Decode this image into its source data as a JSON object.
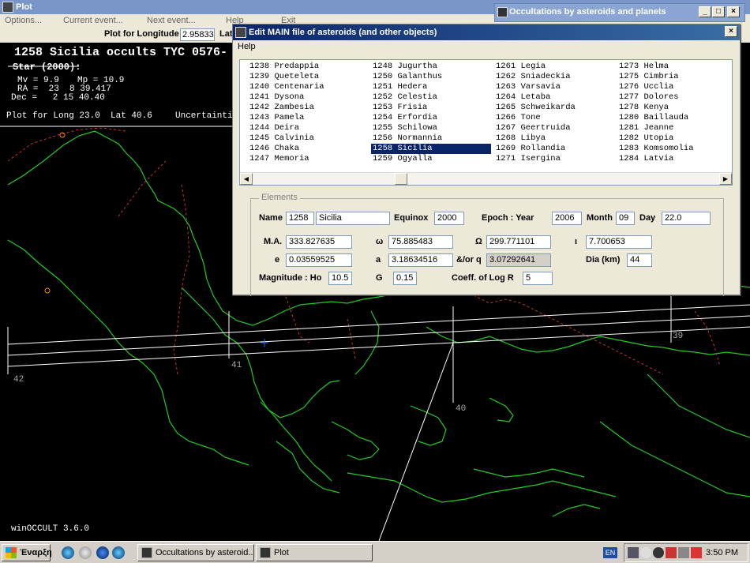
{
  "plot_window": {
    "title": "Plot",
    "menu": [
      "Options...",
      "Current event...",
      "Next event...",
      "Help",
      "Exit"
    ],
    "toolbar": {
      "longitude_label": "Plot for Longitude",
      "longitude_value": "2.95833",
      "lat_label": "Lat"
    },
    "header": {
      "event_title": "1258 Sicilia occults TYC 0576-",
      "star_heading": "Star (2000):",
      "mv": "Mv = 9.9",
      "mp": "Mp = 10.9",
      "ra": "RA =  23  8 39.417",
      "dec": "Dec =   2 15 40.40",
      "plot_for": "Plot for Long 23.0  Lat 40.6",
      "uncertainty": "Uncertainti"
    },
    "lat_labels": [
      "42",
      "41",
      "40",
      "39"
    ],
    "version": "winOCCULT 3.6.0"
  },
  "occultations_window": {
    "title": "Occultations by asteroids and planets"
  },
  "edit_window": {
    "title": "Edit MAIN file of asteroids (and other objects)",
    "menu": "Help",
    "asteroid_columns": [
      [
        "1238 Predappia",
        "1239 Queteleta",
        "1240 Centenaria",
        "1241 Dysona",
        "1242 Zambesia",
        "1243 Pamela",
        "1244 Deira",
        "1245 Calvinia",
        "1246 Chaka",
        "1247 Memoria"
      ],
      [
        "1248 Jugurtha",
        "1250 Galanthus",
        "1251 Hedera",
        "1252 Celestia",
        "1253 Frisia",
        "1254 Erfordia",
        "1255 Schilowa",
        "1256 Normannia",
        "1258 Sicilia",
        "1259 Ogyalla"
      ],
      [
        "1261 Legia",
        "1262 Sniadeckia",
        "1263 Varsavia",
        "1264 Letaba",
        "1265 Schweikarda",
        "1266 Tone",
        "1267 Geertruida",
        "1268 Libya",
        "1269 Rollandia",
        "1271 Isergina"
      ],
      [
        "1273 Helma",
        "1275 Cimbria",
        "1276 Ucclia",
        "1277 Dolores",
        "1278 Kenya",
        "1280 Baillauda",
        "1281 Jeanne",
        "1282 Utopia",
        "1283 Komsomolia",
        "1284 Latvia"
      ]
    ],
    "selected": "1258 Sicilia",
    "elements": {
      "legend": "Elements",
      "name_label": "Name",
      "number": "1258",
      "name": "Sicilia",
      "equinox_label": "Equinox",
      "equinox": "2000",
      "epoch_label": "Epoch :  Year",
      "year": "2006",
      "month_label": "Month",
      "month": "09",
      "day_label": "Day",
      "day": "22.0",
      "ma_label": "M.A.",
      "ma": "333.827635",
      "omega_small_label": "ω",
      "omega_small": "75.885483",
      "omega_big_label": "Ω",
      "omega_big": "299.771101",
      "i_label": "ι",
      "i": "7.700653",
      "e_label": "e",
      "e": "0.03559525",
      "a_label": "a",
      "a": "3.18634516",
      "q_label": "&/or q",
      "q": "3.07292641",
      "dia_label": "Dia (km)",
      "dia": "44",
      "mag_label": "Magnitude :  Ho",
      "ho": "10.5",
      "g_label": "G",
      "g": "0.15",
      "coeff_label": "Coeff. of Log R",
      "coeff": "5"
    }
  },
  "taskbar": {
    "start": "Έναρξη",
    "tasks": [
      "Occultations by asteroid...",
      "Plot"
    ],
    "lang": "EN",
    "clock": "3:50 PM"
  }
}
